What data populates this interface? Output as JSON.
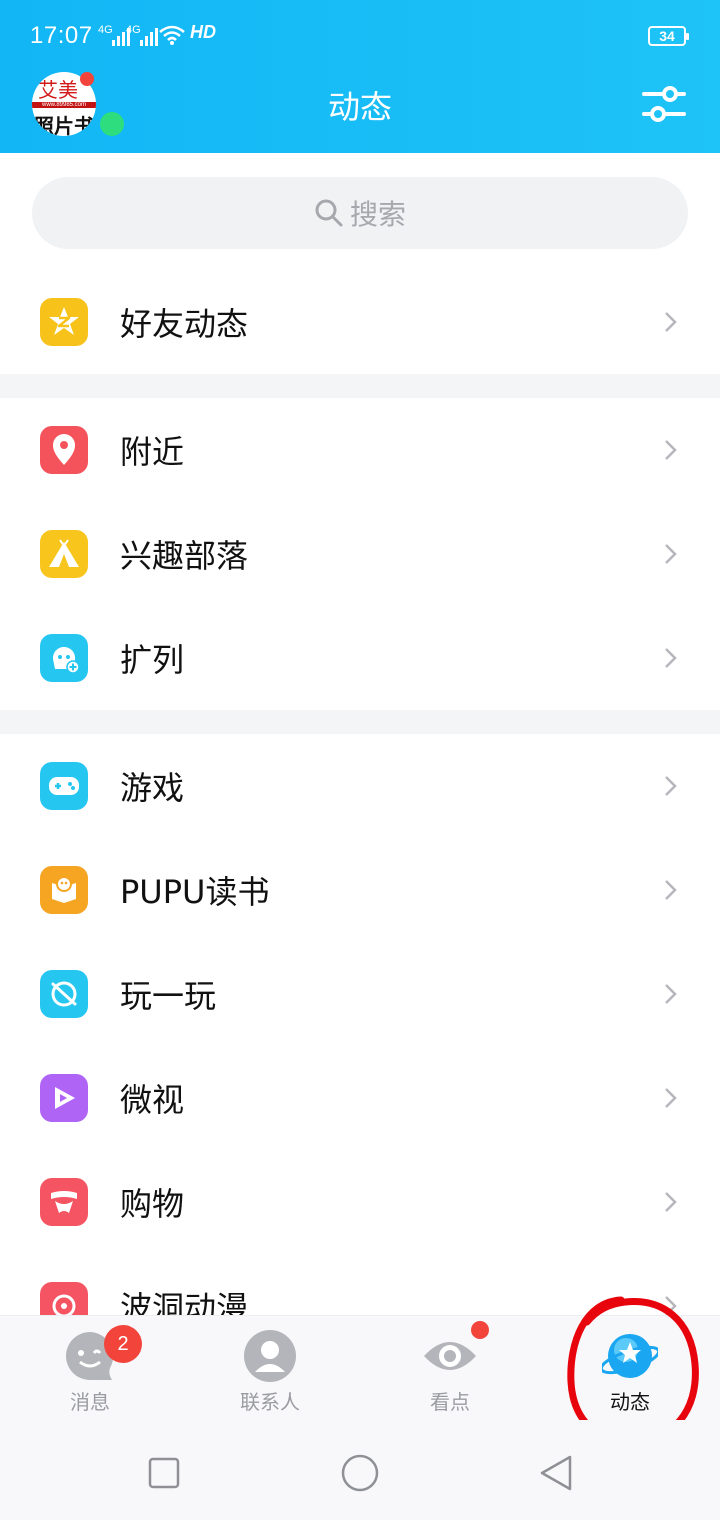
{
  "status_bar": {
    "time": "17:07",
    "signal_1": "4G",
    "signal_2": "4G",
    "hd": "HD",
    "battery": "34"
  },
  "header": {
    "title": "动态",
    "avatar_text_top": "艾美",
    "avatar_text_url": "www.89985.com",
    "avatar_text_bottom": "照片书"
  },
  "search": {
    "placeholder": "搜索"
  },
  "sections": [
    {
      "items": [
        {
          "label": "好友动态",
          "icon": "qzone-star-icon",
          "color": "#f7c21a"
        }
      ]
    },
    {
      "items": [
        {
          "label": "附近",
          "icon": "location-pin-icon",
          "color": "#f5535c"
        },
        {
          "label": "兴趣部落",
          "icon": "tent-icon",
          "color": "#f8c51c"
        },
        {
          "label": "扩列",
          "icon": "add-friend-face-icon",
          "color": "#25c6f0"
        }
      ]
    },
    {
      "items": [
        {
          "label": "游戏",
          "icon": "gamepad-icon",
          "color": "#25c6f0"
        },
        {
          "label": "PUPU读书",
          "icon": "book-reader-icon",
          "color": "#f6a523"
        },
        {
          "label": "玩一玩",
          "icon": "planet-orbit-icon",
          "color": "#25c6f0"
        },
        {
          "label": "微视",
          "icon": "play-video-icon",
          "color": "#b064f5"
        },
        {
          "label": "购物",
          "icon": "bow-gift-icon",
          "color": "#f55563"
        },
        {
          "label": "波洞动漫",
          "icon": "anime-icon",
          "color": "#f55563"
        }
      ]
    }
  ],
  "tabs": [
    {
      "label": "消息",
      "icon": "message-face-icon",
      "badge": "2",
      "active": false
    },
    {
      "label": "联系人",
      "icon": "contacts-person-icon",
      "active": false
    },
    {
      "label": "看点",
      "icon": "eye-icon",
      "active": false
    },
    {
      "label": "动态",
      "icon": "planet-star-icon",
      "active": true
    }
  ],
  "colors": {
    "header_gradient_start": "#12b6f5",
    "header_gradient_end": "#1ec3f7",
    "badge_red": "#f3443c",
    "online_green": "#2ede7e",
    "active_tab_blue": "#1aa6f0"
  }
}
